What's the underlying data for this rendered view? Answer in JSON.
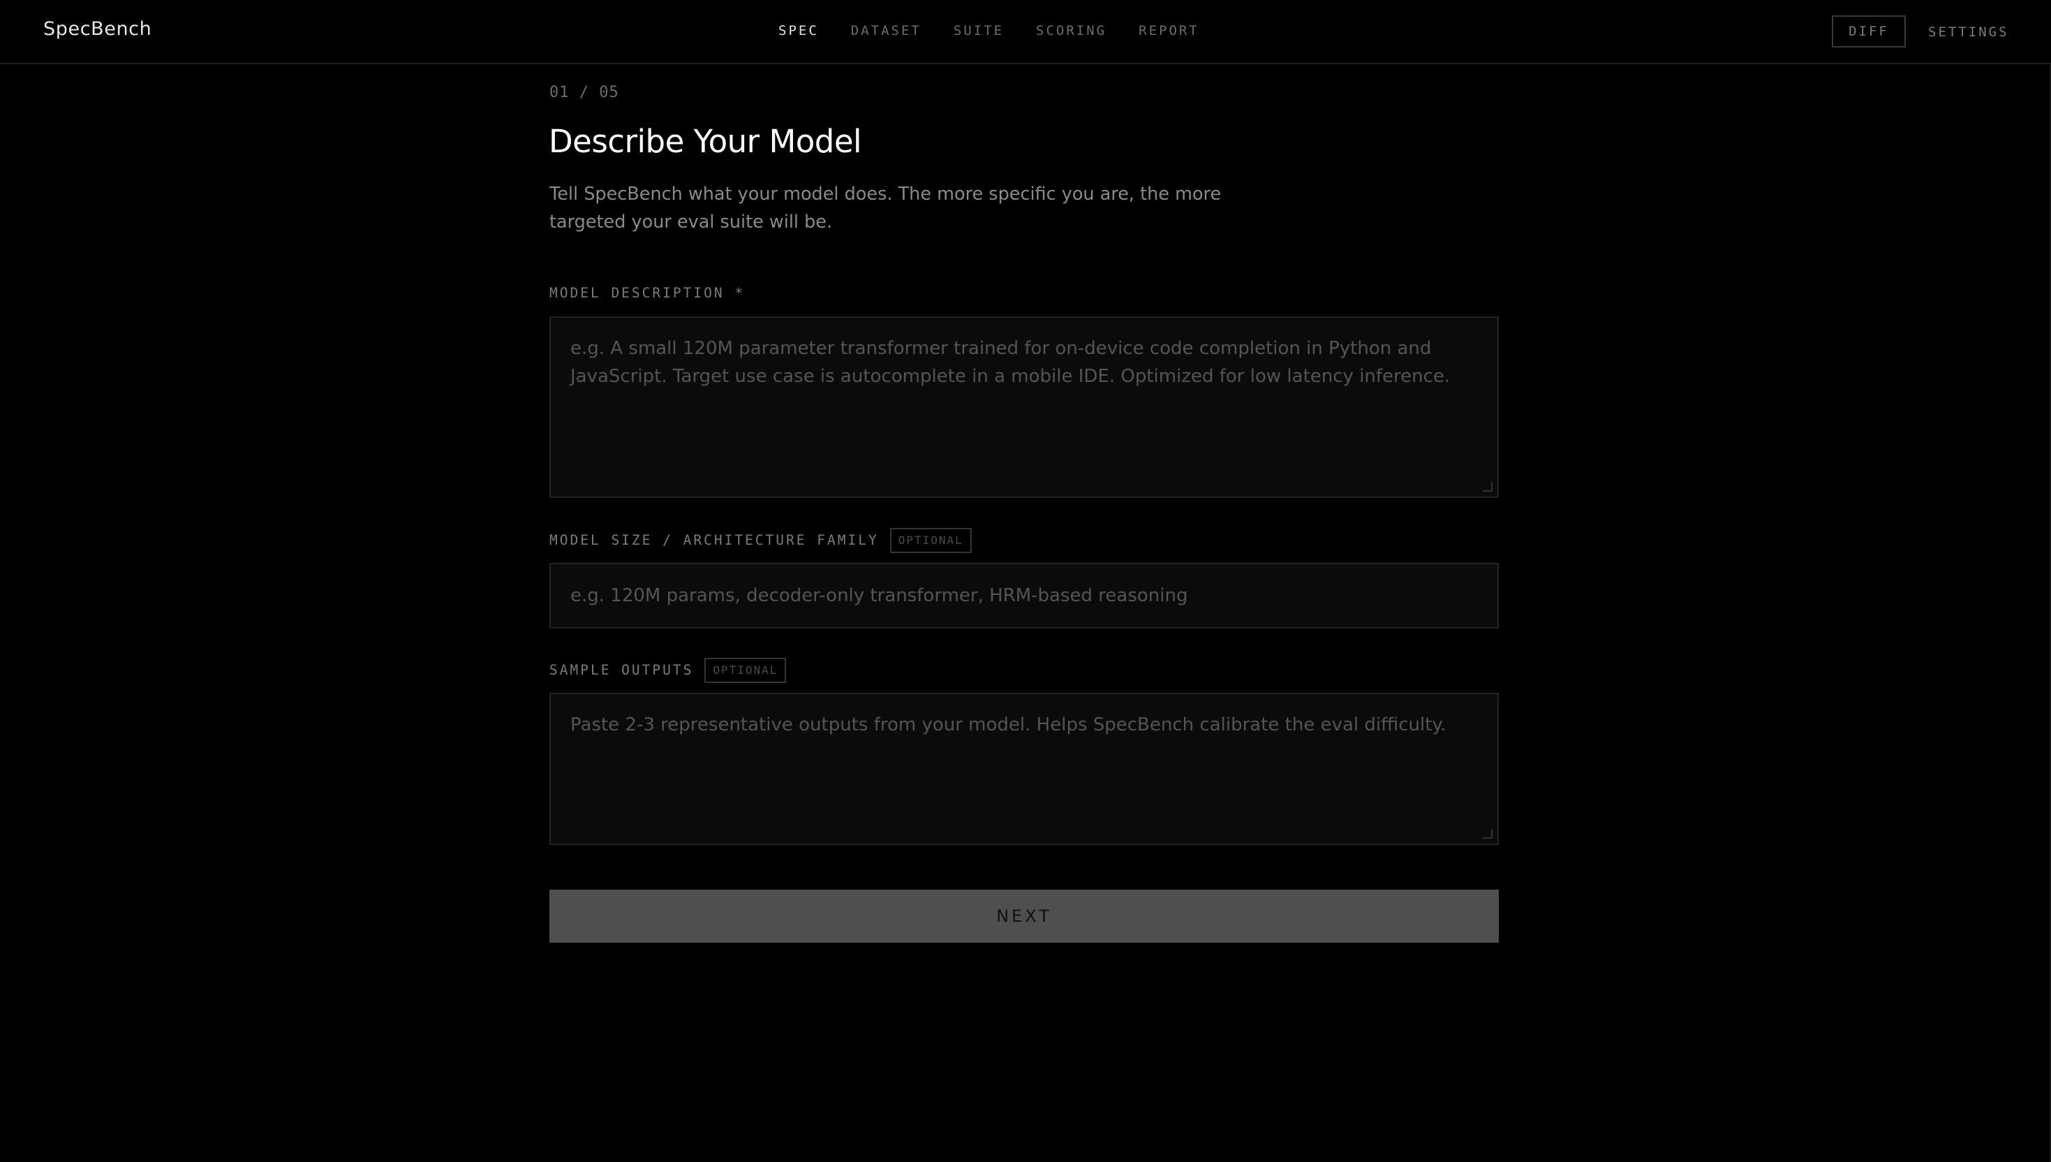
{
  "app": {
    "brand": "SpecBench"
  },
  "nav": {
    "items": [
      {
        "label": "SPEC",
        "active": true
      },
      {
        "label": "DATASET",
        "active": false
      },
      {
        "label": "SUITE",
        "active": false
      },
      {
        "label": "SCORING",
        "active": false
      },
      {
        "label": "REPORT",
        "active": false
      }
    ],
    "diff_label": "DIFF",
    "settings_label": "SETTINGS"
  },
  "form": {
    "step": "01 / 05",
    "title": "Describe Your Model",
    "description": "Tell SpecBench what your model does. The more specific you are, the more targeted your eval suite will be.",
    "model_description": {
      "label": "MODEL DESCRIPTION *",
      "value": "",
      "placeholder": "e.g. A small 120M parameter transformer trained for on-device code completion in Python and JavaScript. Target use case is autocomplete in a mobile IDE. Optimized for low latency inference."
    },
    "model_size": {
      "label": "MODEL SIZE / ARCHITECTURE FAMILY",
      "badge": "OPTIONAL",
      "value": "",
      "placeholder": "e.g. 120M params, decoder-only transformer, HRM-based reasoning"
    },
    "sample_outputs": {
      "label": "SAMPLE OUTPUTS",
      "badge": "OPTIONAL",
      "value": "",
      "placeholder": "Paste 2-3 representative outputs from your model. Helps SpecBench calibrate the eval difficulty."
    },
    "next_label": "NEXT"
  },
  "colors": {
    "background": "#000000",
    "input_bg": "#0b0b0b",
    "button_bg": "#4f4f4f",
    "active_nav": "#e3e3e3",
    "muted_text": "#6d6d6d"
  }
}
